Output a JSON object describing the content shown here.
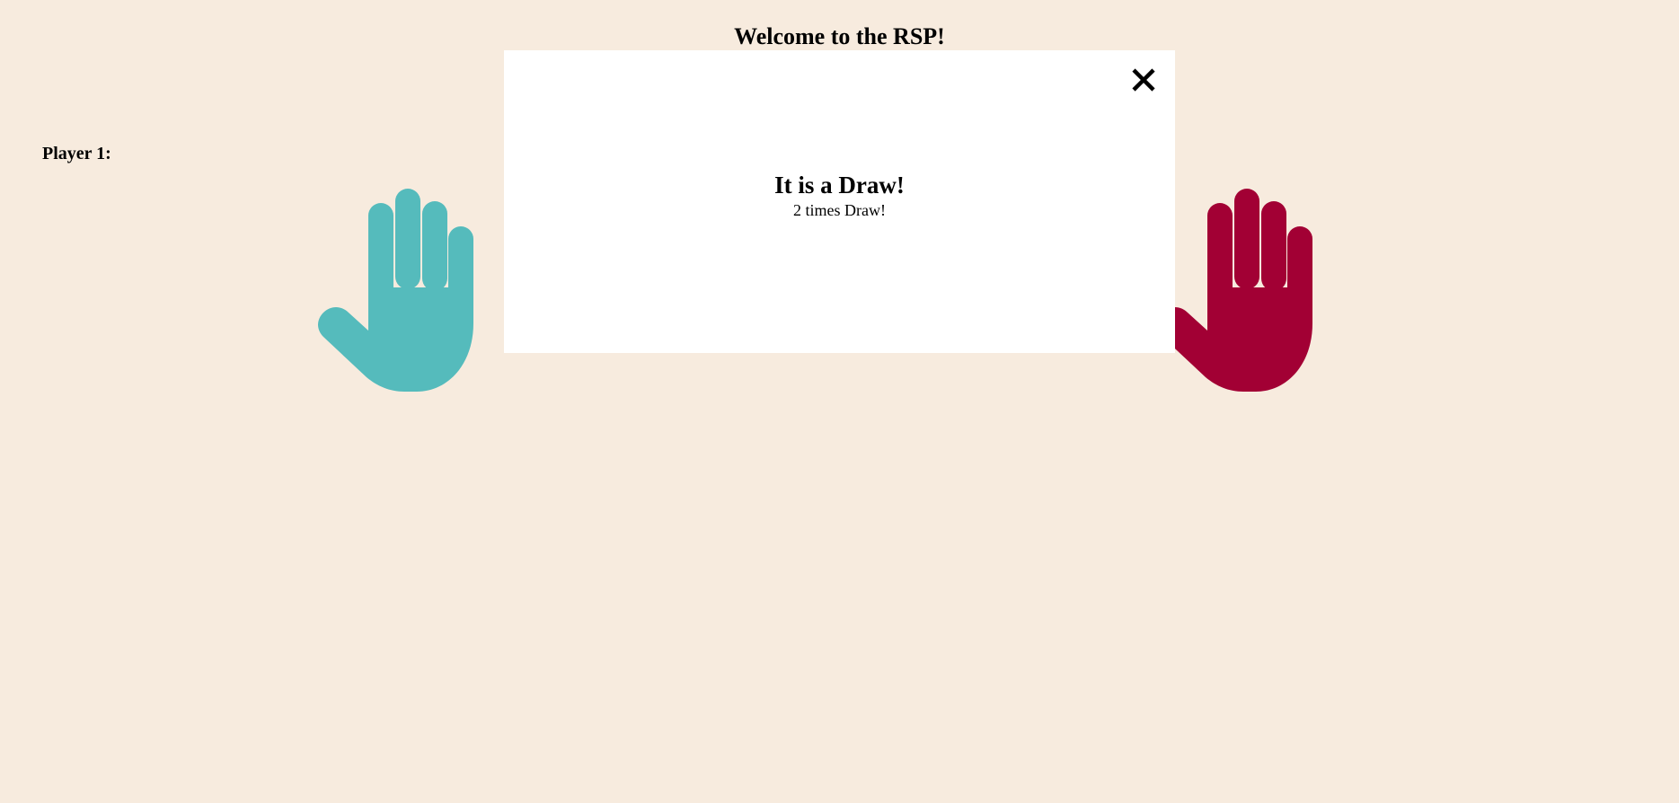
{
  "page": {
    "title": "Welcome to the RSP!"
  },
  "players": {
    "player1_label": "Player 1:"
  },
  "hands": {
    "left": {
      "gesture": "paper-hand-icon",
      "color": "#55bbbc"
    },
    "right": {
      "gesture": "paper-hand-icon",
      "color": "#a20034"
    }
  },
  "modal": {
    "heading": "It is a Draw!",
    "subtext": "2 times Draw!",
    "close_icon": "close-icon"
  },
  "colors": {
    "background": "#f7ebde",
    "modal_background": "#ffffff"
  }
}
